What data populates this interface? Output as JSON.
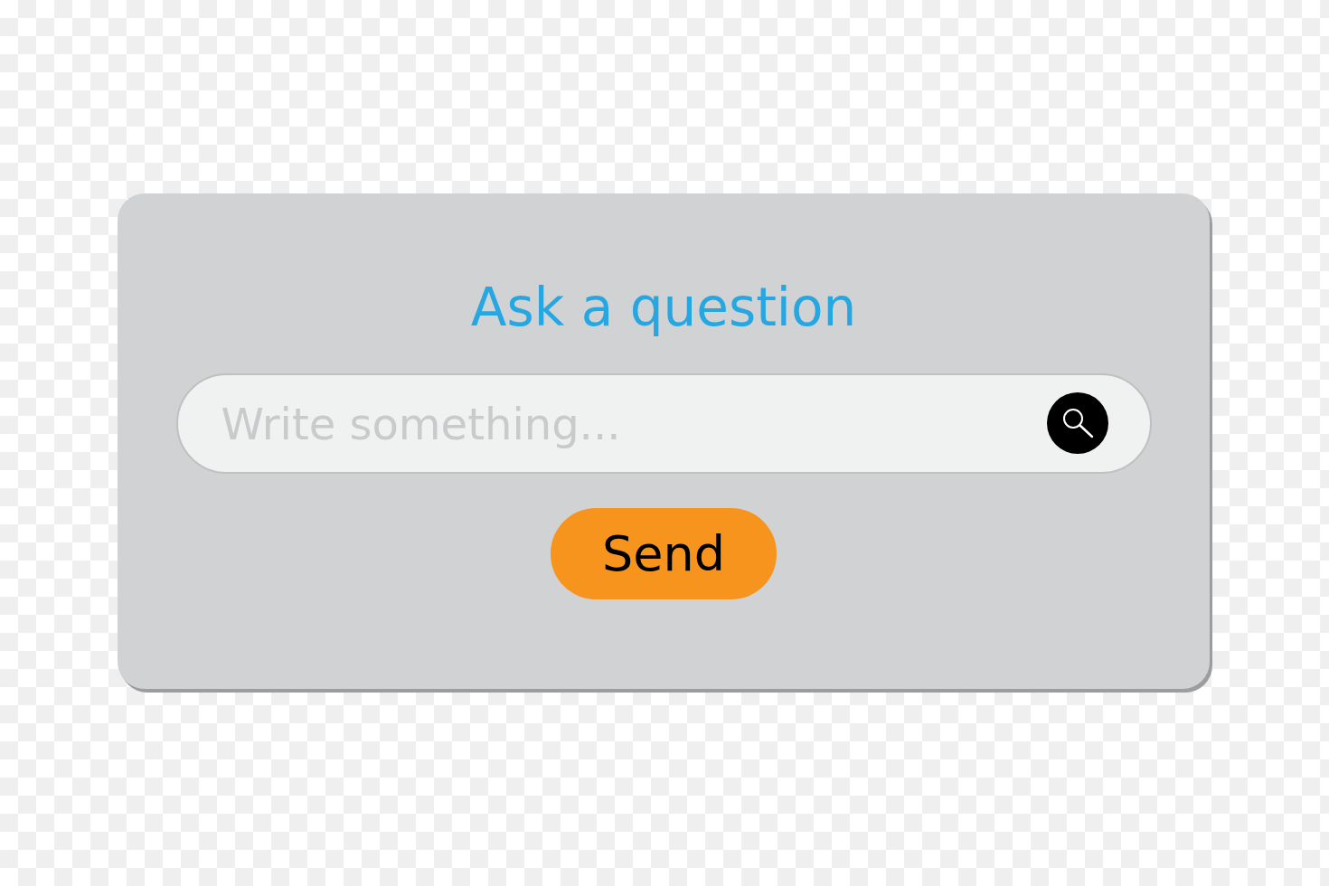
{
  "title": "Ask a question",
  "search": {
    "placeholder": "Write something..."
  },
  "button": {
    "label": "Send"
  }
}
